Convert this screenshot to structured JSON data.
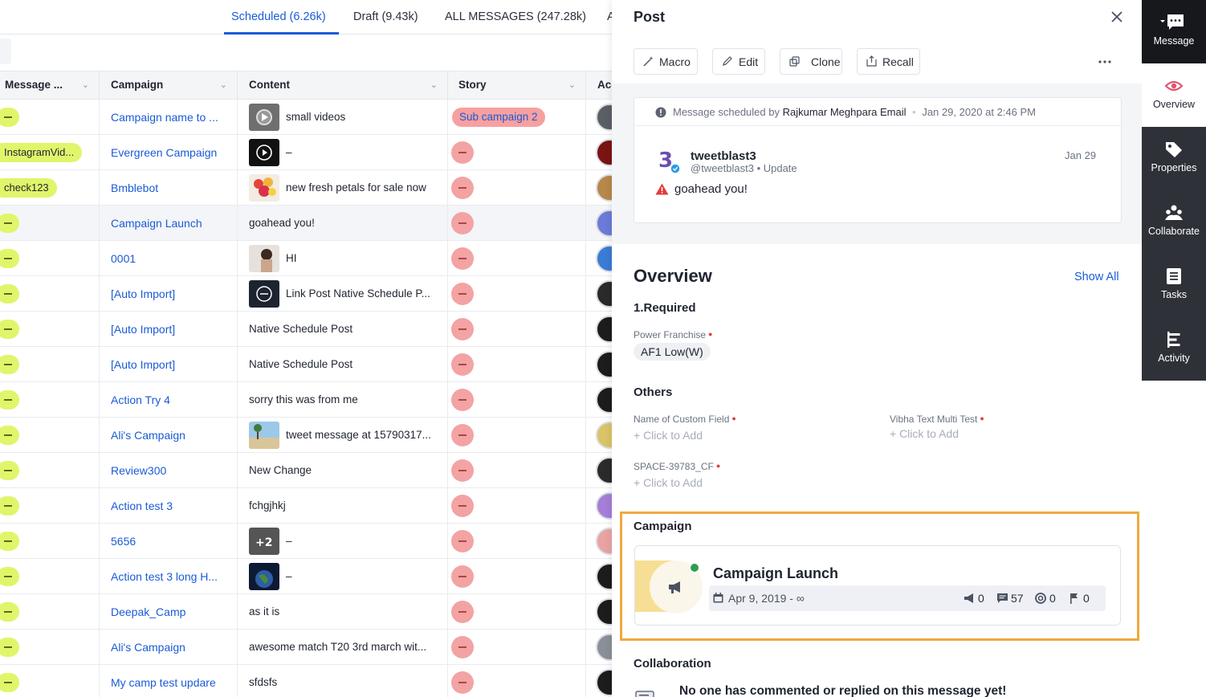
{
  "tabs": [
    {
      "label": "Scheduled (6.26k)",
      "active": true
    },
    {
      "label": "Draft (9.43k)",
      "active": false
    },
    {
      "label": "ALL MESSAGES (247.28k)",
      "active": false
    },
    {
      "label": "A",
      "active": false
    }
  ],
  "table": {
    "columns": [
      "Message ...",
      "Campaign",
      "Content",
      "Story",
      "Acc"
    ],
    "rows": [
      {
        "message": "",
        "campaign": "Campaign name to ...",
        "content": "small videos",
        "story": "Sub campaign 2",
        "thumb": "video",
        "avatar": "#5a5f66"
      },
      {
        "message": "InstagramVid...",
        "campaign": "Evergreen Campaign",
        "content": "–",
        "story": "",
        "thumb": "play",
        "avatar": "#7a1414"
      },
      {
        "message": "check123",
        "campaign": "Bmblebot",
        "content": "new fresh petals for sale now",
        "story": "",
        "thumb": "flowers",
        "avatar": "#b8874a"
      },
      {
        "message": "",
        "campaign": "Campaign Launch",
        "content": "goahead you!",
        "story": "",
        "thumb": "",
        "avatar": "#6b7bd8"
      },
      {
        "message": "",
        "campaign": "0001",
        "content": "HI",
        "story": "",
        "thumb": "person",
        "avatar": "#3a7bd5"
      },
      {
        "message": "",
        "campaign": "[Auto Import]",
        "content": "Link Post Native Schedule P...",
        "story": "",
        "thumb": "link",
        "avatar": "#2a2a2a"
      },
      {
        "message": "",
        "campaign": "[Auto Import]",
        "content": "Native Schedule Post",
        "story": "",
        "thumb": "",
        "avatar": "#1c1c1c"
      },
      {
        "message": "",
        "campaign": "[Auto Import]",
        "content": "Native Schedule Post",
        "story": "",
        "thumb": "",
        "avatar": "#1c1c1c"
      },
      {
        "message": "",
        "campaign": "Action Try 4",
        "content": "sorry this was from me",
        "story": "",
        "thumb": "",
        "avatar": "#1c1c1c"
      },
      {
        "message": "",
        "campaign": "Ali's Campaign",
        "content": "tweet message at 15790317...",
        "story": "",
        "thumb": "beach",
        "avatar": "#d9c46a"
      },
      {
        "message": "",
        "campaign": "Review300",
        "content": "New Change",
        "story": "",
        "thumb": "",
        "avatar": "#2b2b2b"
      },
      {
        "message": "",
        "campaign": "Action test 3",
        "content": "fchgjhkj",
        "story": "",
        "thumb": "",
        "avatar": "#a57ed8"
      },
      {
        "message": "",
        "campaign": "5656",
        "content": "–",
        "story": "",
        "thumb": "plus2",
        "avatar": "#e8a3a3"
      },
      {
        "message": "",
        "campaign": "Action test 3 long H...",
        "content": "–",
        "story": "",
        "thumb": "earth",
        "avatar": "#1c1c1c"
      },
      {
        "message": "",
        "campaign": "Deepak_Camp",
        "content": "as it is",
        "story": "",
        "thumb": "",
        "avatar": "#1c1c1c"
      },
      {
        "message": "",
        "campaign": "Ali's Campaign",
        "content": "awesome match T20 3rd march wit...",
        "story": "",
        "thumb": "",
        "avatar": "#8a8f98"
      },
      {
        "message": "",
        "campaign": "My camp test updare",
        "content": "sfdsfs",
        "story": "",
        "thumb": "",
        "avatar": "#1c1c1c"
      }
    ]
  },
  "panel": {
    "title": "Post",
    "actions": [
      "Macro",
      "Edit",
      "Clone",
      "Recall"
    ],
    "schedule": {
      "prefix": "Message scheduled by",
      "author": "Rajkumar Meghpara Email",
      "sep": "•",
      "when": "Jan 29, 2020 at 2:46 PM"
    },
    "post": {
      "user": "tweetblast3",
      "handle": "@tweetblast3 • Update",
      "date": "Jan 29",
      "text": "goahead you!"
    },
    "overview": {
      "title": "Overview",
      "show_all": "Show All",
      "required_title": "1.Required",
      "power_franchise_label": "Power Franchise",
      "power_franchise_value": "AF1 Low(W)",
      "others_title": "Others",
      "custom_field_label": "Name of Custom Field",
      "vibha_label": "Vibha Text Multi Test",
      "space_label": "SPACE-39783_CF",
      "click_to_add": "+ Click to Add"
    },
    "campaign": {
      "title": "Campaign",
      "name": "Campaign Launch",
      "dates": "Apr 9, 2019 - ∞",
      "stats": {
        "sent": "0",
        "comments": "57",
        "targets": "0",
        "flags": "0"
      },
      "status_color": "#2f9e4b"
    },
    "collaboration": {
      "title": "Collaboration",
      "empty_text": "No one has commented or replied on this message yet!"
    }
  },
  "sidebar": [
    {
      "label": "Message",
      "icon": "message-icon",
      "active": false
    },
    {
      "label": "Overview",
      "icon": "eye-icon",
      "active": true
    },
    {
      "label": "Properties",
      "icon": "tag-icon",
      "active": false
    },
    {
      "label": "Collaborate",
      "icon": "people-icon",
      "active": false
    },
    {
      "label": "Tasks",
      "icon": "tasks-icon",
      "active": false
    },
    {
      "label": "Activity",
      "icon": "activity-icon",
      "active": false
    }
  ],
  "colors": {
    "accent": "#1a5bd6",
    "highlight_border": "#f0a93e",
    "sidebar_bg": "#2e3138"
  }
}
